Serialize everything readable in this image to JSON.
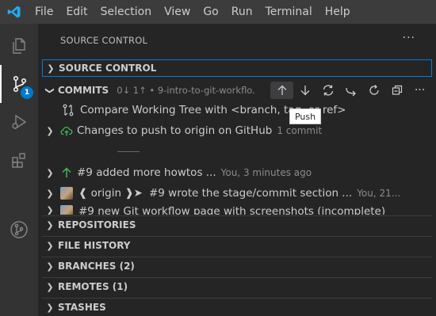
{
  "menubar": {
    "logo": "vscode-logo",
    "items": [
      "File",
      "Edit",
      "Selection",
      "View",
      "Go",
      "Run",
      "Terminal",
      "Help"
    ]
  },
  "activitybar": {
    "items": [
      "explorer-icon",
      "source-control-icon",
      "run-debug-icon",
      "extensions-icon",
      "gitlens-icon"
    ],
    "scm_badge": "1"
  },
  "sidebar": {
    "title": "SOURCE CONTROL",
    "more": "···",
    "sections": {
      "source_control": "SOURCE CONTROL",
      "commits": "COMMITS",
      "repositories": "REPOSITORIES",
      "file_history": "FILE HISTORY",
      "branches": "BRANCHES (2)",
      "remotes": "REMOTES (1)",
      "stashes": "STASHES"
    },
    "commits_meta": "0↓ 1↑ • 9-intro-to-git-workflo...",
    "tooltip": "Push",
    "rows": {
      "compare": "Compare Working Tree with <branch, tag, or ref>",
      "changes": "Changes to push to origin on GitHub",
      "changes_desc": "1 commit",
      "commit1": "#9 added more howtos ...",
      "commit1_desc": "You, 3 minutes ago",
      "commit2_tag": "❰ origin ❱➤",
      "commit2": "#9 wrote the stage/commit section ...",
      "commit2_desc": "You, 21...",
      "commit3": "#9 new Git workflow page with screenshots (incomplete)"
    }
  },
  "colors": {
    "accent": "#007acc",
    "focus_border": "#007fd4",
    "push_green": "#3fb950",
    "logo_blue": "#23a9f2"
  }
}
